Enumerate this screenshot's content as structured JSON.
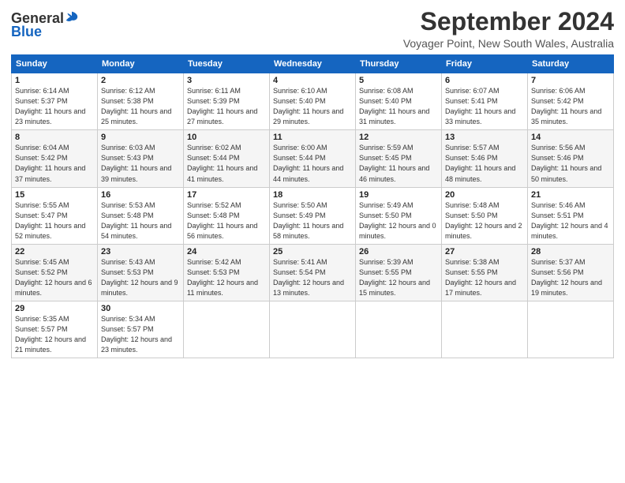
{
  "header": {
    "logo_general": "General",
    "logo_blue": "Blue",
    "month_title": "September 2024",
    "subtitle": "Voyager Point, New South Wales, Australia"
  },
  "days_of_week": [
    "Sunday",
    "Monday",
    "Tuesday",
    "Wednesday",
    "Thursday",
    "Friday",
    "Saturday"
  ],
  "weeks": [
    [
      {
        "day": "1",
        "sunrise": "6:14 AM",
        "sunset": "5:37 PM",
        "daylight": "11 hours and 23 minutes."
      },
      {
        "day": "2",
        "sunrise": "6:12 AM",
        "sunset": "5:38 PM",
        "daylight": "11 hours and 25 minutes."
      },
      {
        "day": "3",
        "sunrise": "6:11 AM",
        "sunset": "5:39 PM",
        "daylight": "11 hours and 27 minutes."
      },
      {
        "day": "4",
        "sunrise": "6:10 AM",
        "sunset": "5:40 PM",
        "daylight": "11 hours and 29 minutes."
      },
      {
        "day": "5",
        "sunrise": "6:08 AM",
        "sunset": "5:40 PM",
        "daylight": "11 hours and 31 minutes."
      },
      {
        "day": "6",
        "sunrise": "6:07 AM",
        "sunset": "5:41 PM",
        "daylight": "11 hours and 33 minutes."
      },
      {
        "day": "7",
        "sunrise": "6:06 AM",
        "sunset": "5:42 PM",
        "daylight": "11 hours and 35 minutes."
      }
    ],
    [
      {
        "day": "8",
        "sunrise": "6:04 AM",
        "sunset": "5:42 PM",
        "daylight": "11 hours and 37 minutes."
      },
      {
        "day": "9",
        "sunrise": "6:03 AM",
        "sunset": "5:43 PM",
        "daylight": "11 hours and 39 minutes."
      },
      {
        "day": "10",
        "sunrise": "6:02 AM",
        "sunset": "5:44 PM",
        "daylight": "11 hours and 41 minutes."
      },
      {
        "day": "11",
        "sunrise": "6:00 AM",
        "sunset": "5:44 PM",
        "daylight": "11 hours and 44 minutes."
      },
      {
        "day": "12",
        "sunrise": "5:59 AM",
        "sunset": "5:45 PM",
        "daylight": "11 hours and 46 minutes."
      },
      {
        "day": "13",
        "sunrise": "5:57 AM",
        "sunset": "5:46 PM",
        "daylight": "11 hours and 48 minutes."
      },
      {
        "day": "14",
        "sunrise": "5:56 AM",
        "sunset": "5:46 PM",
        "daylight": "11 hours and 50 minutes."
      }
    ],
    [
      {
        "day": "15",
        "sunrise": "5:55 AM",
        "sunset": "5:47 PM",
        "daylight": "11 hours and 52 minutes."
      },
      {
        "day": "16",
        "sunrise": "5:53 AM",
        "sunset": "5:48 PM",
        "daylight": "11 hours and 54 minutes."
      },
      {
        "day": "17",
        "sunrise": "5:52 AM",
        "sunset": "5:48 PM",
        "daylight": "11 hours and 56 minutes."
      },
      {
        "day": "18",
        "sunrise": "5:50 AM",
        "sunset": "5:49 PM",
        "daylight": "11 hours and 58 minutes."
      },
      {
        "day": "19",
        "sunrise": "5:49 AM",
        "sunset": "5:50 PM",
        "daylight": "12 hours and 0 minutes."
      },
      {
        "day": "20",
        "sunrise": "5:48 AM",
        "sunset": "5:50 PM",
        "daylight": "12 hours and 2 minutes."
      },
      {
        "day": "21",
        "sunrise": "5:46 AM",
        "sunset": "5:51 PM",
        "daylight": "12 hours and 4 minutes."
      }
    ],
    [
      {
        "day": "22",
        "sunrise": "5:45 AM",
        "sunset": "5:52 PM",
        "daylight": "12 hours and 6 minutes."
      },
      {
        "day": "23",
        "sunrise": "5:43 AM",
        "sunset": "5:53 PM",
        "daylight": "12 hours and 9 minutes."
      },
      {
        "day": "24",
        "sunrise": "5:42 AM",
        "sunset": "5:53 PM",
        "daylight": "12 hours and 11 minutes."
      },
      {
        "day": "25",
        "sunrise": "5:41 AM",
        "sunset": "5:54 PM",
        "daylight": "12 hours and 13 minutes."
      },
      {
        "day": "26",
        "sunrise": "5:39 AM",
        "sunset": "5:55 PM",
        "daylight": "12 hours and 15 minutes."
      },
      {
        "day": "27",
        "sunrise": "5:38 AM",
        "sunset": "5:55 PM",
        "daylight": "12 hours and 17 minutes."
      },
      {
        "day": "28",
        "sunrise": "5:37 AM",
        "sunset": "5:56 PM",
        "daylight": "12 hours and 19 minutes."
      }
    ],
    [
      {
        "day": "29",
        "sunrise": "5:35 AM",
        "sunset": "5:57 PM",
        "daylight": "12 hours and 21 minutes."
      },
      {
        "day": "30",
        "sunrise": "5:34 AM",
        "sunset": "5:57 PM",
        "daylight": "12 hours and 23 minutes."
      },
      null,
      null,
      null,
      null,
      null
    ]
  ],
  "labels": {
    "sunrise": "Sunrise:",
    "sunset": "Sunset:",
    "daylight": "Daylight:"
  }
}
